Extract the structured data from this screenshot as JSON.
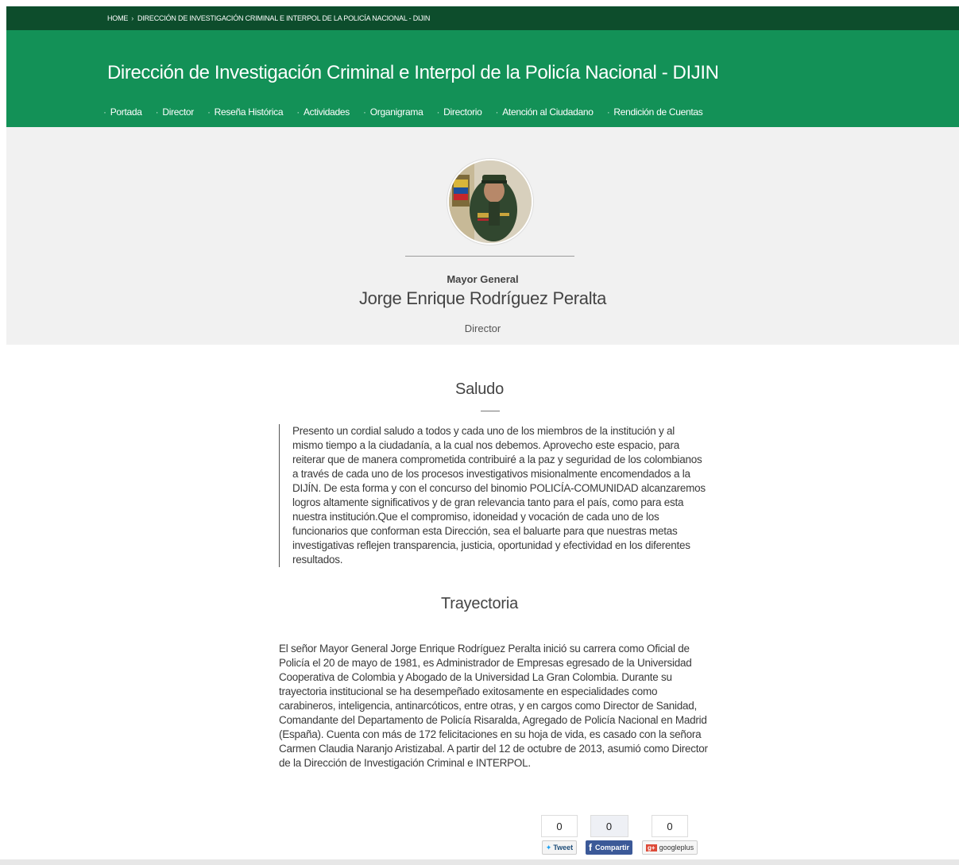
{
  "breadcrumb": {
    "home": "HOME",
    "current": "DIRECCIÓN DE INVESTIGACIÓN CRIMINAL E INTERPOL DE LA POLICÍA NACIONAL - DIJIN"
  },
  "header": {
    "title": "Dirección de Investigación Criminal e Interpol de la Policía Nacional - DIJIN"
  },
  "nav": {
    "items": [
      {
        "label": "Portada"
      },
      {
        "label": "Director"
      },
      {
        "label": "Reseña Histórica"
      },
      {
        "label": "Actividades"
      },
      {
        "label": "Organigrama"
      },
      {
        "label": "Directorio"
      },
      {
        "label": "Atención al Ciudadano"
      },
      {
        "label": "Rendición de Cuentas"
      }
    ],
    "bullet": "·"
  },
  "profile": {
    "rank": "Mayor General",
    "name": "Jorge Enrique Rodríguez Peralta",
    "role": "Director"
  },
  "saludo": {
    "title": "Saludo",
    "text": "Presento un cordial saludo a todos y cada uno de los miembros de la institución y al mismo tiempo a la ciudadanía, a la cual nos debemos. Aprovecho este espacio, para reiterar que de manera comprometida contribuiré a la paz y seguridad de los colombianos a través de cada uno de los procesos investigativos misionalmente encomendados a la DIJÍN. De esta forma y con el concurso del binomio POLICÍA-COMUNIDAD alcanzaremos logros altamente significativos y de gran relevancia tanto para el país, como para esta nuestra institución.Que el compromiso, idoneidad y vocación de cada uno de los funcionarios que conforman esta Dirección, sea el baluarte para que nuestras metas investigativas reflejen transparencia, justicia, oportunidad y efectividad en los diferentes resultados."
  },
  "trayectoria": {
    "title": "Trayectoria",
    "text": "El señor Mayor General Jorge Enrique Rodríguez Peralta inició su carrera como Oficial de Policía el 20 de mayo de 1981, es Administrador de Empresas egresado de la Universidad Cooperativa de Colombia y Abogado de la Universidad La Gran Colombia. Durante su trayectoria institucional se ha desempeñado exitosamente en especialidades como carabineros, inteligencia, antinarcóticos, entre otras, y en cargos como Director de Sanidad, Comandante del Departamento de Policía Risaralda, Agregado de Policía Nacional en Madrid (España). Cuenta con más de 172 felicitaciones en su hoja de vida, es casado con la señora Carmen Claudia Naranjo Aristizabal. A partir del 12 de octubre de 2013, asumió como Director de la Dirección de Investigación Criminal e INTERPOL."
  },
  "share": {
    "twitter": {
      "count": "0",
      "label": "Tweet",
      "icon": "twitter-bird-icon"
    },
    "facebook": {
      "count": "0",
      "label": "Compartir",
      "icon": "facebook-f-icon"
    },
    "google": {
      "count": "0",
      "label": "googleplus",
      "icon": "google-plus-icon"
    }
  },
  "colors": {
    "topbar": "#0d4d2c",
    "header": "#139157",
    "profile_bg": "#f1f1f1"
  }
}
